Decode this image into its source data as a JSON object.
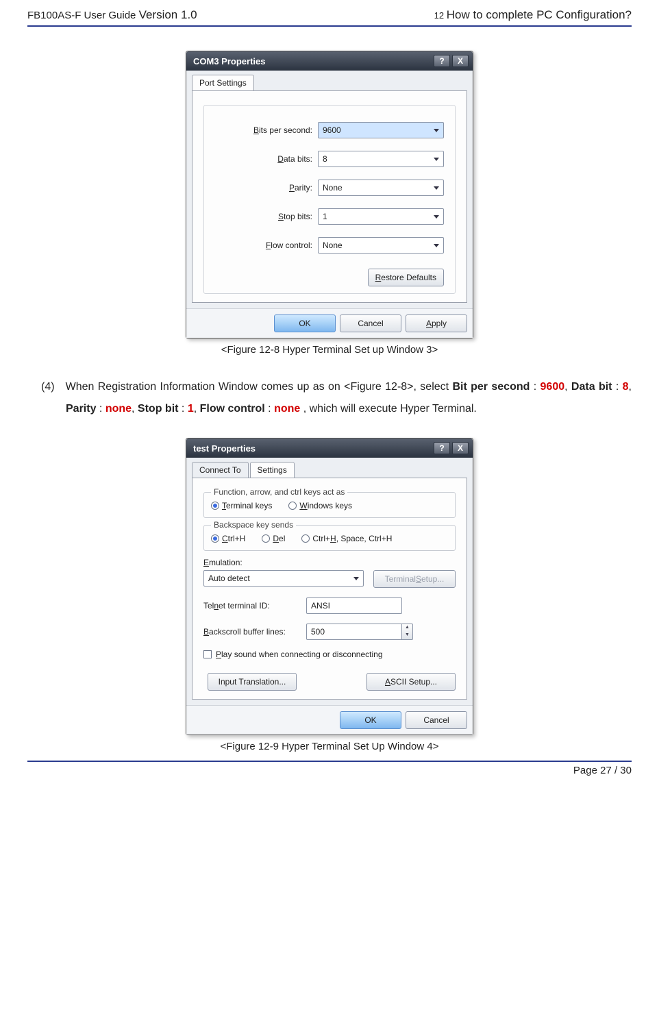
{
  "header": {
    "left_prefix": "FB100AS-F User Guide ",
    "left_version": "Version 1.0",
    "right_num": "12 ",
    "right_title": "How to complete PC Configuration?"
  },
  "dialog1": {
    "title": "COM3 Properties",
    "help": "?",
    "close": "X",
    "tab": "Port Settings",
    "rows": {
      "bps_label": "Bits per second:",
      "bps_value": "9600",
      "databits_label": "Data bits:",
      "databits_value": "8",
      "parity_label": "Parity:",
      "parity_value": "None",
      "stopbits_label": "Stop bits:",
      "stopbits_value": "1",
      "flow_label": "Flow control:",
      "flow_value": "None"
    },
    "restore": "Restore Defaults",
    "ok": "OK",
    "cancel": "Cancel",
    "apply": "Apply"
  },
  "caption1": "<Figure 12-8 Hyper Terminal Set up Window 3>",
  "para": {
    "num": "(4)",
    "t1": "When Registration Information Window comes up as on <Figure 12-8>, select ",
    "bps_lbl": "Bit per second",
    "colon": " : ",
    "bps_val": "9600",
    "comma": ", ",
    "db_lbl": "Data bit",
    "db_val": "8",
    "par_lbl": "Parity",
    "par_val": "none",
    "sb_lbl": "Stop bit",
    "sb_val": "1",
    "fc_lbl": "Flow control",
    "fc_val": "none",
    "tail": ", which will execute Hyper Terminal."
  },
  "dialog2": {
    "title": "test Properties",
    "help": "?",
    "close": "X",
    "tab_connect": "Connect To",
    "tab_settings": "Settings",
    "fs1_legend": "Function, arrow, and ctrl keys act as",
    "fs1_opt1": "Terminal keys",
    "fs1_opt2": "Windows keys",
    "fs2_legend": "Backspace key sends",
    "fs2_opt1": "Ctrl+H",
    "fs2_opt2": "Del",
    "fs2_opt3": "Ctrl+H, Space, Ctrl+H",
    "emulation_label": "Emulation:",
    "emulation_value": "Auto detect",
    "terminal_setup": "Terminal Setup...",
    "telnet_label": "Telnet terminal ID:",
    "telnet_value": "ANSI",
    "backscroll_label": "Backscroll buffer lines:",
    "backscroll_value": "500",
    "play_sound": "Play sound when connecting or disconnecting",
    "input_translation": "Input Translation...",
    "ascii_setup": "ASCII Setup...",
    "ok": "OK",
    "cancel": "Cancel"
  },
  "caption2": "<Figure 12-9 Hyper Terminal Set Up Window 4>",
  "footer": "Page 27 / 30"
}
